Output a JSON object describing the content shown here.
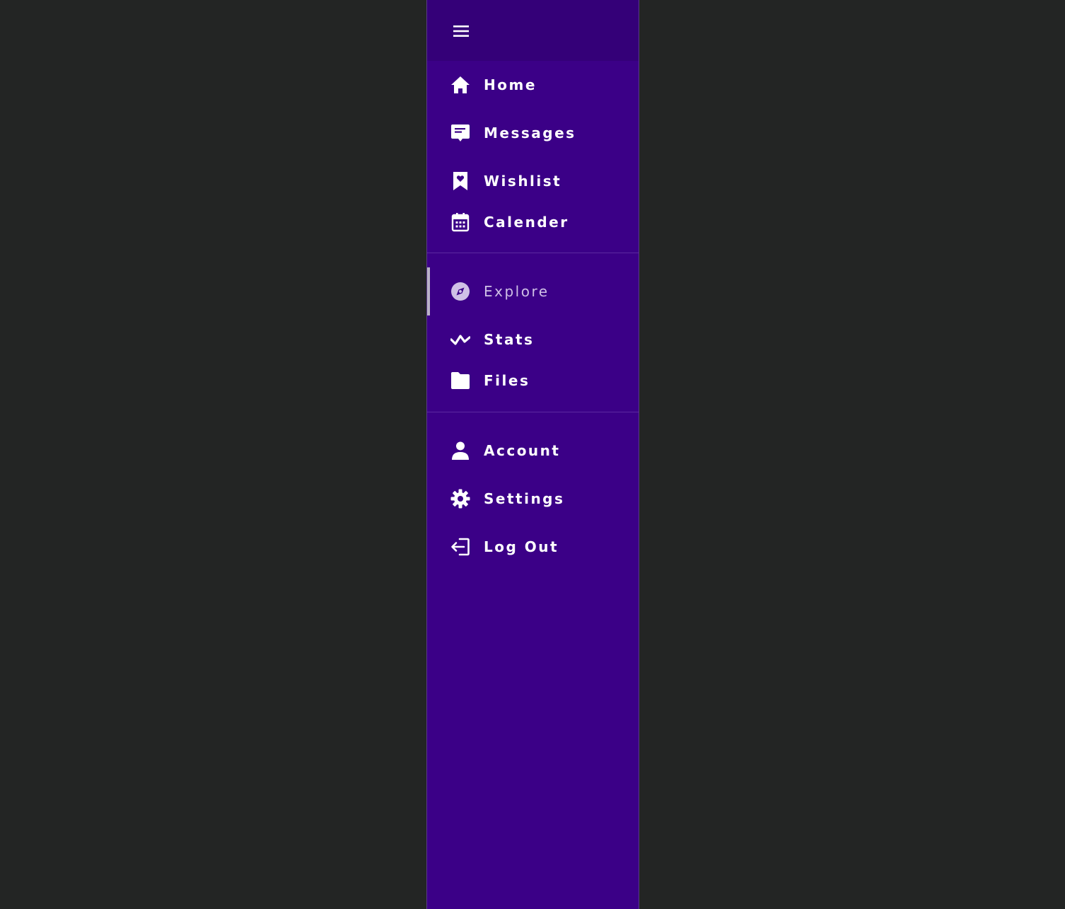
{
  "sidebar": {
    "toggle_icon": "hamburger-menu-icon",
    "items": [
      {
        "label": "Home",
        "icon": "home-icon"
      },
      {
        "label": "Messages",
        "icon": "message-icon"
      },
      {
        "label": "Wishlist",
        "icon": "bookmark-heart-icon"
      },
      {
        "label": "Calender",
        "icon": "calendar-icon"
      },
      {
        "label": "Explore",
        "icon": "compass-icon",
        "active": true
      },
      {
        "label": "Stats",
        "icon": "activity-icon"
      },
      {
        "label": "Files",
        "icon": "folder-icon"
      },
      {
        "label": "Account",
        "icon": "user-icon"
      },
      {
        "label": "Settings",
        "icon": "gear-icon"
      },
      {
        "label": "Log Out",
        "icon": "logout-icon"
      }
    ]
  },
  "colors": {
    "background": "#232524",
    "sidebar": "#3b0087",
    "sidebar_header": "#340078",
    "text": "#ffffff",
    "active_text": "#cfc0e6",
    "active_indicator": "#b9b3c6"
  }
}
